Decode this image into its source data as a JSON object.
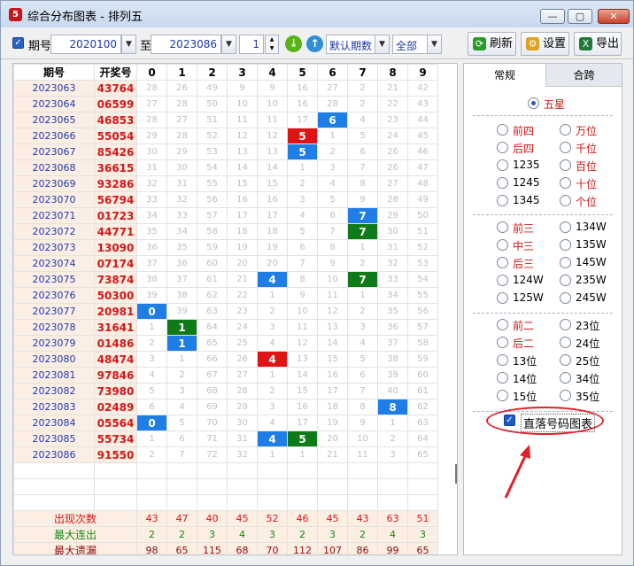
{
  "window": {
    "title": "综合分布图表 - 排列五",
    "icon_text": "5",
    "min": "—",
    "max": "▢",
    "close": "✕"
  },
  "toolbar": {
    "period_label": "期号",
    "from": "2020100",
    "to_label": "至",
    "to": "2023086",
    "count": "1",
    "default_label": "默认期数",
    "all_label": "全部",
    "refresh": "刷新",
    "settings": "设置",
    "export": "导出"
  },
  "table": {
    "headers": [
      "期号",
      "开奖号",
      "0",
      "1",
      "2",
      "3",
      "4",
      "5",
      "6",
      "7",
      "8",
      "9"
    ],
    "rows": [
      {
        "p": "2023063",
        "d": "43764",
        "c": [
          "28",
          "26",
          "49",
          "9",
          "9",
          "16",
          "27",
          "2",
          "21",
          "42"
        ],
        "h": []
      },
      {
        "p": "2023064",
        "d": "06599",
        "c": [
          "27",
          "28",
          "50",
          "10",
          "10",
          "16",
          "28",
          "2",
          "22",
          "43"
        ],
        "h": []
      },
      {
        "p": "2023065",
        "d": "46853",
        "c": [
          "28",
          "27",
          "51",
          "11",
          "11",
          "17",
          "6",
          "4",
          "23",
          "44"
        ],
        "h": [
          [
            6,
            0
          ]
        ]
      },
      {
        "p": "2023066",
        "d": "55054",
        "c": [
          "29",
          "28",
          "52",
          "12",
          "12",
          "5",
          "1",
          "5",
          "24",
          "45"
        ],
        "h": [
          [
            5,
            2
          ]
        ]
      },
      {
        "p": "2023067",
        "d": "85426",
        "c": [
          "30",
          "29",
          "53",
          "13",
          "13",
          "5",
          "2",
          "6",
          "26",
          "46"
        ],
        "h": [
          [
            5,
            0
          ]
        ]
      },
      {
        "p": "2023068",
        "d": "36615",
        "c": [
          "31",
          "30",
          "54",
          "14",
          "14",
          "1",
          "3",
          "7",
          "26",
          "47"
        ],
        "h": []
      },
      {
        "p": "2023069",
        "d": "93286",
        "c": [
          "32",
          "31",
          "55",
          "15",
          "15",
          "2",
          "4",
          "8",
          "27",
          "48"
        ],
        "h": []
      },
      {
        "p": "2023070",
        "d": "56794",
        "c": [
          "33",
          "32",
          "56",
          "16",
          "16",
          "3",
          "5",
          "9",
          "28",
          "49"
        ],
        "h": []
      },
      {
        "p": "2023071",
        "d": "01723",
        "c": [
          "34",
          "33",
          "57",
          "17",
          "17",
          "4",
          "6",
          "7",
          "29",
          "50"
        ],
        "h": [
          [
            7,
            0
          ]
        ]
      },
      {
        "p": "2023072",
        "d": "44771",
        "c": [
          "35",
          "34",
          "58",
          "18",
          "18",
          "5",
          "7",
          "7",
          "30",
          "51"
        ],
        "h": [
          [
            7,
            1
          ]
        ]
      },
      {
        "p": "2023073",
        "d": "13090",
        "c": [
          "36",
          "35",
          "59",
          "19",
          "19",
          "6",
          "8",
          "1",
          "31",
          "52"
        ],
        "h": []
      },
      {
        "p": "2023074",
        "d": "07174",
        "c": [
          "37",
          "36",
          "60",
          "20",
          "20",
          "7",
          "9",
          "2",
          "32",
          "53"
        ],
        "h": []
      },
      {
        "p": "2023075",
        "d": "73874",
        "c": [
          "38",
          "37",
          "61",
          "21",
          "4",
          "8",
          "10",
          "7",
          "33",
          "54"
        ],
        "h": [
          [
            4,
            0
          ],
          [
            7,
            1
          ]
        ]
      },
      {
        "p": "2023076",
        "d": "50300",
        "c": [
          "39",
          "38",
          "62",
          "22",
          "1",
          "9",
          "11",
          "1",
          "34",
          "55"
        ],
        "h": []
      },
      {
        "p": "2023077",
        "d": "20981",
        "c": [
          "0",
          "39",
          "63",
          "23",
          "2",
          "10",
          "12",
          "2",
          "35",
          "56"
        ],
        "h": [
          [
            0,
            0
          ]
        ]
      },
      {
        "p": "2023078",
        "d": "31641",
        "c": [
          "1",
          "1",
          "64",
          "24",
          "3",
          "11",
          "13",
          "3",
          "36",
          "57"
        ],
        "h": [
          [
            1,
            1
          ]
        ]
      },
      {
        "p": "2023079",
        "d": "01486",
        "c": [
          "2",
          "1",
          "65",
          "25",
          "4",
          "12",
          "14",
          "4",
          "37",
          "58"
        ],
        "h": [
          [
            1,
            0
          ]
        ]
      },
      {
        "p": "2023080",
        "d": "48474",
        "c": [
          "3",
          "1",
          "66",
          "26",
          "4",
          "13",
          "15",
          "5",
          "38",
          "59"
        ],
        "h": [
          [
            4,
            2
          ]
        ]
      },
      {
        "p": "2023081",
        "d": "97846",
        "c": [
          "4",
          "2",
          "67",
          "27",
          "1",
          "14",
          "16",
          "6",
          "39",
          "60"
        ],
        "h": []
      },
      {
        "p": "2023082",
        "d": "73980",
        "c": [
          "5",
          "3",
          "68",
          "28",
          "2",
          "15",
          "17",
          "7",
          "40",
          "61"
        ],
        "h": []
      },
      {
        "p": "2023083",
        "d": "02489",
        "c": [
          "6",
          "4",
          "69",
          "29",
          "3",
          "16",
          "18",
          "8",
          "8",
          "62"
        ],
        "h": [
          [
            8,
            0
          ]
        ]
      },
      {
        "p": "2023084",
        "d": "05564",
        "c": [
          "0",
          "5",
          "70",
          "30",
          "4",
          "17",
          "19",
          "9",
          "1",
          "63"
        ],
        "h": [
          [
            0,
            0
          ]
        ]
      },
      {
        "p": "2023085",
        "d": "55734",
        "c": [
          "1",
          "6",
          "71",
          "31",
          "4",
          "5",
          "20",
          "10",
          "2",
          "64"
        ],
        "h": [
          [
            4,
            0
          ],
          [
            5,
            1
          ]
        ]
      },
      {
        "p": "2023086",
        "d": "91550",
        "c": [
          "2",
          "7",
          "72",
          "32",
          "1",
          "1",
          "21",
          "11",
          "3",
          "65"
        ],
        "h": []
      }
    ],
    "footer": [
      {
        "label": "出现次数",
        "color": "#d41616",
        "values": [
          "43",
          "47",
          "40",
          "45",
          "52",
          "46",
          "45",
          "43",
          "63",
          "51"
        ],
        "vcolor": "#d41616"
      },
      {
        "label": "最大连出",
        "color": "#138a13",
        "values": [
          "2",
          "2",
          "3",
          "4",
          "3",
          "2",
          "3",
          "2",
          "4",
          "3"
        ],
        "vcolor": "#138a13"
      },
      {
        "label": "最大遗漏",
        "color": "#8b0d0d",
        "values": [
          "98",
          "65",
          "115",
          "68",
          "70",
          "112",
          "107",
          "86",
          "99",
          "65"
        ],
        "vcolor": "#8b0d0d"
      }
    ]
  },
  "panel": {
    "tabs": [
      "常规",
      "合跨"
    ],
    "groups": [
      [
        {
          "l": "五星",
          "on": true
        }
      ],
      [
        {
          "l": "前四"
        },
        {
          "l": "万位"
        },
        {
          "l": "后四"
        },
        {
          "l": "千位"
        },
        {
          "l": "1235",
          "black": true
        },
        {
          "l": "百位"
        },
        {
          "l": "1245",
          "black": true
        },
        {
          "l": "十位"
        },
        {
          "l": "1345",
          "black": true
        },
        {
          "l": "个位"
        }
      ],
      [
        {
          "l": "前三"
        },
        {
          "l": "134W",
          "black": true
        },
        {
          "l": "中三"
        },
        {
          "l": "135W",
          "black": true
        },
        {
          "l": "后三"
        },
        {
          "l": "145W",
          "black": true
        },
        {
          "l": "124W",
          "black": true
        },
        {
          "l": "235W",
          "black": true
        },
        {
          "l": "125W",
          "black": true
        },
        {
          "l": "245W",
          "black": true
        }
      ],
      [
        {
          "l": "前二"
        },
        {
          "l": "23位",
          "black": true
        },
        {
          "l": "后二"
        },
        {
          "l": "24位",
          "black": true
        },
        {
          "l": "13位",
          "black": true
        },
        {
          "l": "25位",
          "black": true
        },
        {
          "l": "14位",
          "black": true
        },
        {
          "l": "34位",
          "black": true
        },
        {
          "l": "15位",
          "black": true
        },
        {
          "l": "35位",
          "black": true
        }
      ]
    ],
    "checkbox_label": "直落号码图表"
  },
  "colors": {
    "blue_cell": "#1e7ee6",
    "green_cell": "#0f7b18",
    "red_cell": "#e01414",
    "annotation": "#e0212a"
  }
}
